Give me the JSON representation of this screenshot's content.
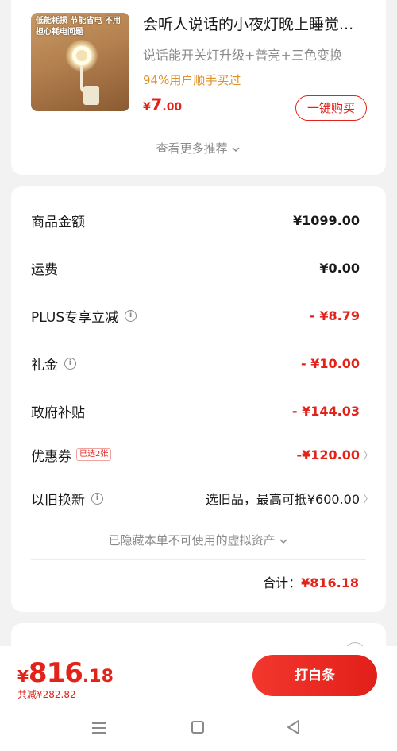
{
  "recommendation": {
    "thumb_caption": "低能耗损 节能省电 不用担心耗电问题",
    "title": "会听人说话的小夜灯晚上睡觉...",
    "subtitle": "说话能开关灯升级+普亮+三色变换",
    "stat": "94%用户顺手买过",
    "price": {
      "currency": "¥",
      "integer": "7",
      "decimal": ".00"
    },
    "buy_button": "一键购买",
    "more_link": "查看更多推荐"
  },
  "summary": {
    "rows": [
      {
        "label": "商品金额",
        "value": "¥1099.00"
      },
      {
        "label": "运费",
        "value": "¥0.00"
      },
      {
        "label": "PLUS专享立减",
        "value": "- ¥8.79"
      },
      {
        "label": "礼金",
        "value": "- ¥10.00"
      },
      {
        "label": "政府补贴",
        "value": "- ¥144.03"
      },
      {
        "label": "优惠券",
        "tag": "已选2张",
        "value": "-¥120.00"
      },
      {
        "label": "以旧换新",
        "value": "选旧品，最高可抵¥600.00"
      }
    ],
    "hidden_assets": "已隐藏本单不可使用的虚拟资产",
    "total_label": "合计：",
    "total_value": "¥816.18"
  },
  "bottom_bar": {
    "price": {
      "currency": "¥",
      "integer": "816",
      "decimal": ".18"
    },
    "saving": "共减¥282.82",
    "pay_button": "打白条"
  },
  "colors": {
    "accent": "#e2231a",
    "stat": "#e0912a",
    "muted": "#8a8a8a"
  },
  "icons": [
    "info-icon",
    "chevron-right-icon",
    "chevron-down-icon",
    "nav-menu-icon",
    "nav-home-icon",
    "nav-back-icon"
  ]
}
